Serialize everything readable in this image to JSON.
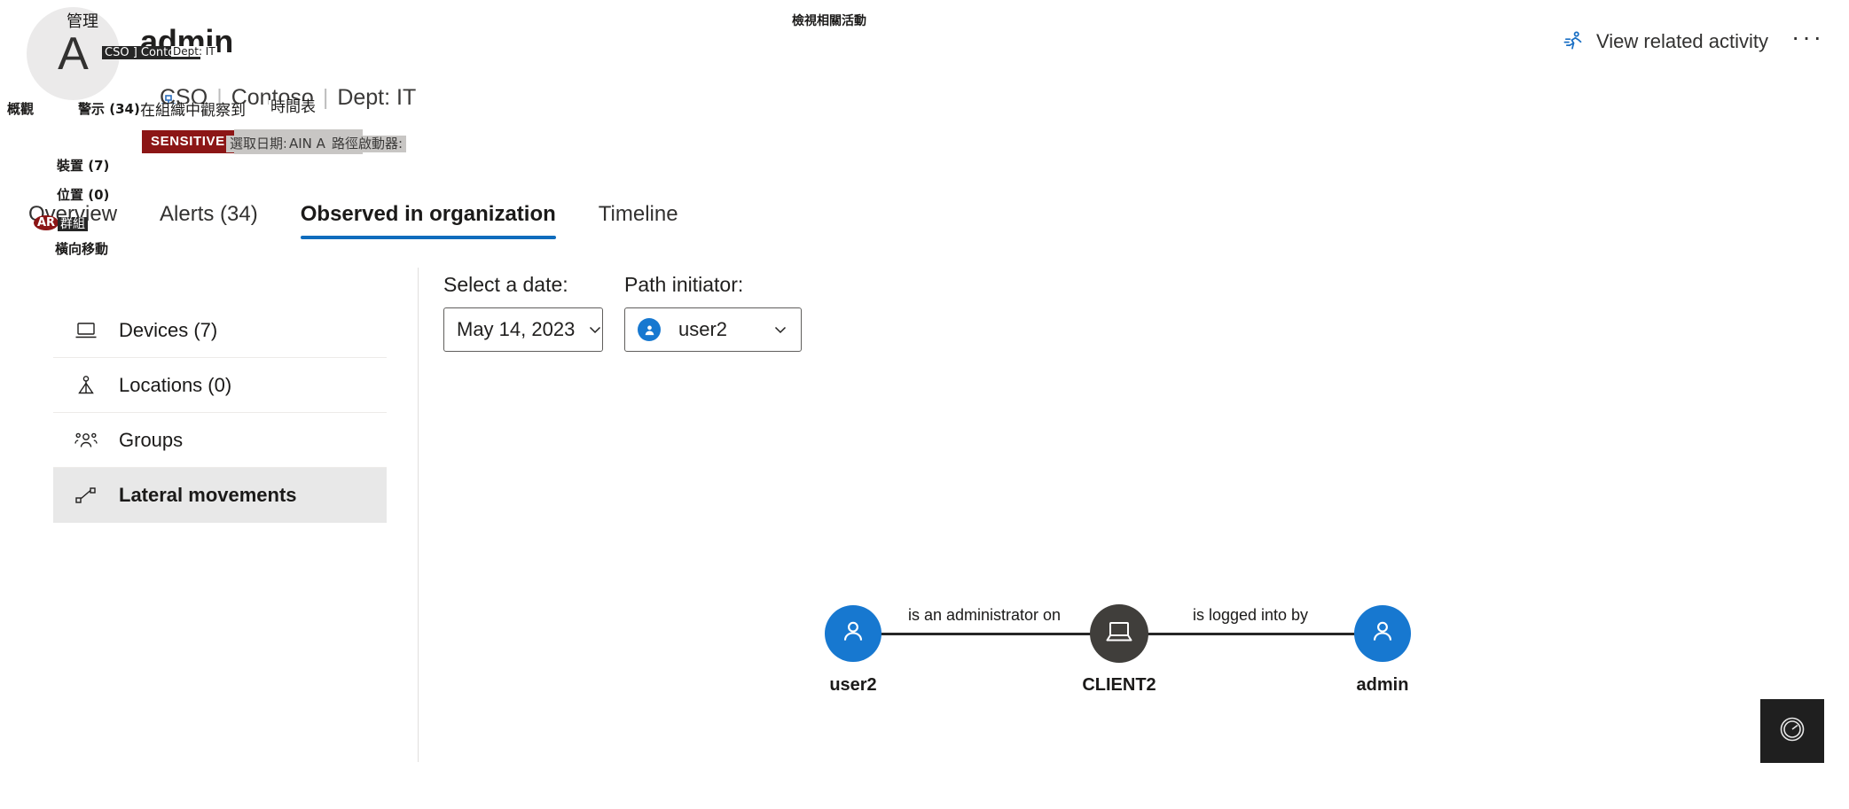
{
  "identity": {
    "avatar_letter": "A",
    "display_name": "admin",
    "meta": [
      "CSO",
      "Contoso",
      "Dept: IT"
    ],
    "separator": "|",
    "sensitive_badge": "SENSITIVE",
    "group_chip": "DOMAIN ADMINS"
  },
  "header": {
    "related_activity_label": "View related activity",
    "ellipsis": "···"
  },
  "tabs": [
    {
      "label": "Overview",
      "active": false
    },
    {
      "label": "Alerts (34)",
      "active": false
    },
    {
      "label": "Observed in organization",
      "active": true
    },
    {
      "label": "Timeline",
      "active": false
    }
  ],
  "nav": {
    "items": [
      {
        "label": "Devices (7)",
        "icon": "laptop-icon",
        "selected": false
      },
      {
        "label": "Locations (0)",
        "icon": "location-person-icon",
        "selected": false
      },
      {
        "label": "Groups",
        "icon": "people-icon",
        "selected": false
      },
      {
        "label": "Lateral movements",
        "icon": "lateral-movement-icon",
        "selected": true
      }
    ]
  },
  "filters": {
    "date": {
      "label": "Select a date:",
      "value": "May 14, 2023"
    },
    "initiator": {
      "label": "Path initiator:",
      "value": "user2"
    }
  },
  "graph": {
    "nodes": [
      {
        "id": "user2",
        "label": "user2",
        "type": "user",
        "color": "#1778d0"
      },
      {
        "id": "client2",
        "label": "CLIENT2",
        "type": "device",
        "color": "#403e3b"
      },
      {
        "id": "admin",
        "label": "admin",
        "type": "user",
        "color": "#1778d0"
      }
    ],
    "edges": [
      {
        "from": "user2",
        "to": "client2",
        "label": "is an administrator on"
      },
      {
        "from": "client2",
        "to": "admin",
        "label": "is logged into by"
      }
    ]
  },
  "fab": {
    "icon": "gauge-icon"
  },
  "overlays": {
    "manage": "管理",
    "cso_contoso": "CSO ] Contoso L",
    "dept_it": "Dept: IT",
    "observed_in_org": "在組織中觀察到",
    "timeline": "時間表",
    "select_date": "選取日期:",
    "path_initiator": "路徑啟動器:",
    "domain_admins_fragment": "AIN A",
    "overview": "概觀",
    "alerts": "警示 (34)",
    "devices": "裝置 (7)",
    "locations": "位置 (0)",
    "groups": "群組",
    "alerts_mini": "AR",
    "lateral_movements": "橫向移動",
    "view_related_activity": "檢視相關活動"
  },
  "colors": {
    "accent": "#0f6cbd",
    "node_user": "#1778d0",
    "node_device": "#403e3b",
    "sensitive": "#8c1616",
    "selected_row": "#e8e8e8"
  }
}
